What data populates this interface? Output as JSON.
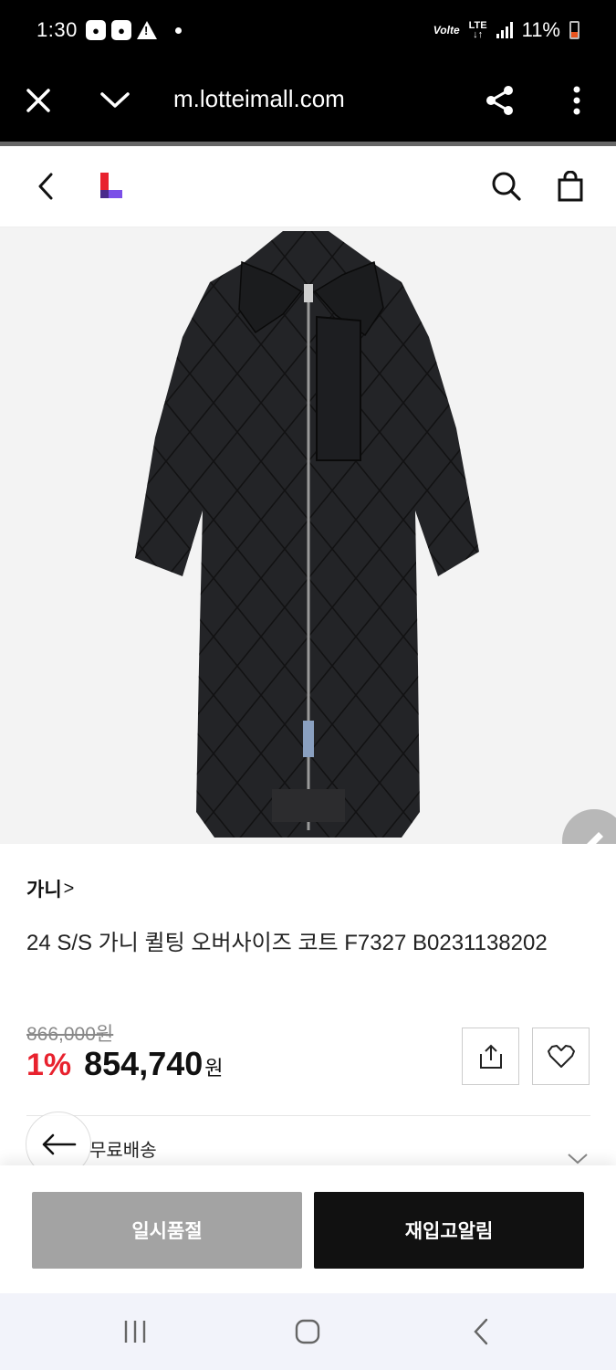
{
  "status_bar": {
    "time": "1:30",
    "volte": "Volte",
    "network": "LTE",
    "battery_percent": "11%"
  },
  "browser": {
    "url": "m.lotteimall.com",
    "icons": [
      "close-icon",
      "chevron-down-icon",
      "share-icon",
      "more-vert-icon"
    ]
  },
  "header": {
    "icons": [
      "back-icon",
      "lotte-logo",
      "search-icon",
      "shopping-bag-icon"
    ],
    "logo_colors": [
      "#e8222e",
      "#7b4fe8"
    ]
  },
  "product": {
    "brand": "가니",
    "brand_chevron": ">",
    "title": "24 S/S 가니 퀼팅 오버사이즈 코트 F7327 B0231138202",
    "original_price": "866,000원",
    "discount": "1%",
    "price": "854,740",
    "price_unit": "원",
    "shipping": "무료배송"
  },
  "actions": {
    "sold_out": "일시품절",
    "restock_alert": "재입고알림"
  },
  "colors": {
    "accent_red": "#e8222e",
    "sold_out_gray": "#a3a3a3",
    "restock_black": "#111111"
  }
}
